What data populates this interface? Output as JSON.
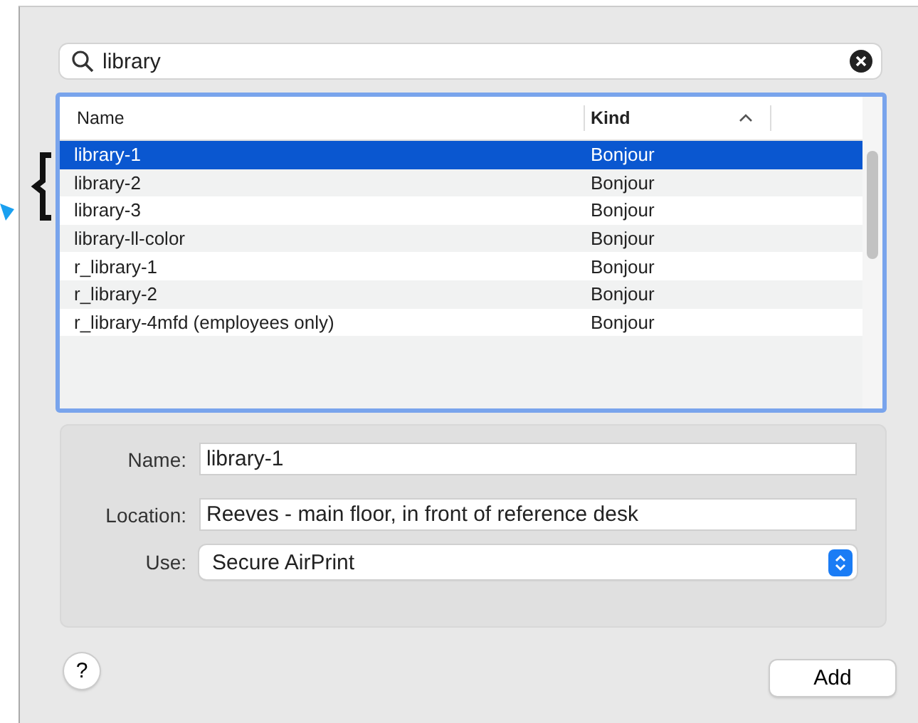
{
  "search": {
    "value": "library"
  },
  "table": {
    "columns": [
      {
        "label": "Name",
        "sorted": false
      },
      {
        "label": "Kind",
        "sorted": true
      }
    ],
    "rows": [
      {
        "name": "library-1",
        "kind": "Bonjour",
        "selected": true
      },
      {
        "name": "library-2",
        "kind": "Bonjour",
        "selected": false
      },
      {
        "name": "library-3",
        "kind": "Bonjour",
        "selected": false
      },
      {
        "name": "library-ll-color",
        "kind": "Bonjour",
        "selected": false
      },
      {
        "name": "r_library-1",
        "kind": "Bonjour",
        "selected": false
      },
      {
        "name": "r_library-2",
        "kind": "Bonjour",
        "selected": false
      },
      {
        "name": "r_library-4mfd (employees only)",
        "kind": "Bonjour",
        "selected": false
      }
    ]
  },
  "form": {
    "fields": [
      {
        "label": "Name:",
        "value": "library-1",
        "kind": "text"
      },
      {
        "label": "Location:",
        "value": "Reeves - main floor, in front of reference desk",
        "kind": "text"
      },
      {
        "label": "Use:",
        "value": "Secure AirPrint",
        "kind": "popup"
      }
    ]
  },
  "help_button": {
    "label": "?"
  },
  "buttons": [
    "Add"
  ]
}
